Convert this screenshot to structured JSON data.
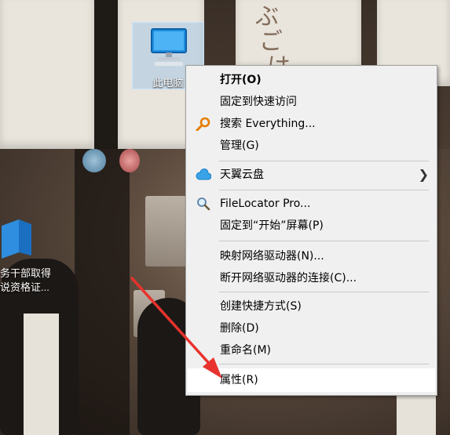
{
  "desktop": {
    "this_pc_label": "此电脑",
    "folder_label_line1": "务干部取得",
    "folder_label_line2": "说资格证..."
  },
  "context_menu": {
    "items": [
      {
        "label": "打开(O)",
        "bold": true
      },
      {
        "label": "固定到快速访问"
      },
      {
        "label": "搜索 Everything...",
        "icon": "everything-search-icon"
      },
      {
        "label": "管理(G)"
      },
      {
        "label": "天翼云盘",
        "icon": "cloud-icon",
        "submenu": true
      },
      {
        "label": "FileLocator Pro...",
        "icon": "magnifier-icon"
      },
      {
        "label": "固定到“开始”屏幕(P)"
      },
      {
        "label": "映射网络驱动器(N)..."
      },
      {
        "label": "断开网络驱动器的连接(C)..."
      },
      {
        "label": "创建快捷方式(S)"
      },
      {
        "label": "删除(D)"
      },
      {
        "label": "重命名(M)"
      },
      {
        "label": "属性(R)",
        "highlighted": true
      }
    ]
  },
  "colors": {
    "menu_bg": "#f0f0f0",
    "annotation_arrow": "#e8322d",
    "selection": "#cce8ff"
  }
}
